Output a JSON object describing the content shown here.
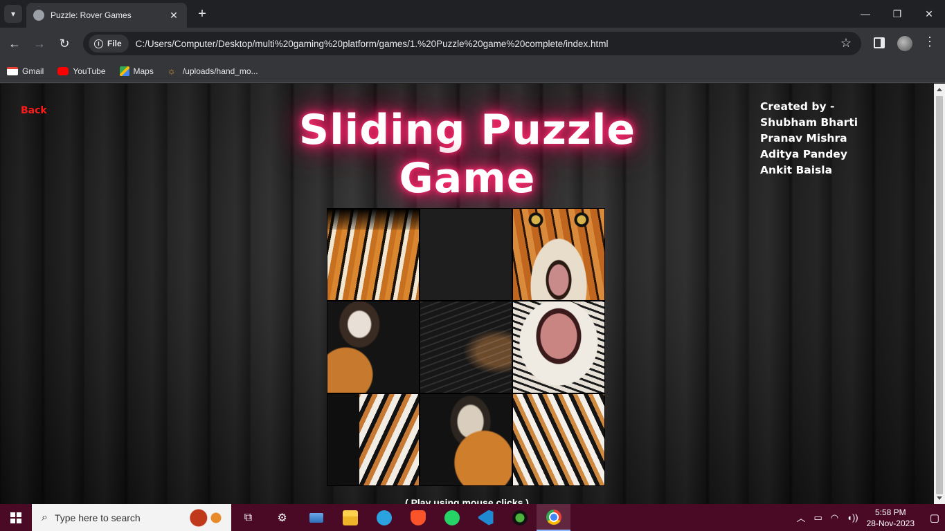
{
  "browser": {
    "tab_title": "Puzzle: Rover Games",
    "new_tab": "+",
    "close_tab": "✕",
    "file_chip": "File",
    "url": "C:/Users/Computer/Desktop/multi%20gaming%20platform/games/1.%20Puzzle%20game%20complete/index.html",
    "bookmarks": [
      "Gmail",
      "YouTube",
      "Maps",
      "/uploads/hand_mo..."
    ]
  },
  "page": {
    "back_label": "Back",
    "title": "Sliding Puzzle Game",
    "credits_heading": "Created by -",
    "authors": [
      "Shubham Bharti",
      "Pranav Mishra",
      "Aditya Pandey",
      "Ankit Baisla"
    ],
    "hint": "( Play using mouse clicks )"
  },
  "puzzle": {
    "grid": [
      [
        "tiger-back-fur",
        "empty",
        "tiger-eyes-nose"
      ],
      [
        "tiger-ear-left",
        "tiger-whisker-dark",
        "tiger-mouth-open"
      ],
      [
        "tiger-cheek-left",
        "tiger-ear-right",
        "tiger-cheek-right"
      ]
    ],
    "empty_position": "row 1, column 2"
  },
  "taskbar": {
    "search_placeholder": "Type here to search",
    "time": "5:58 PM",
    "date": "28-Nov-2023"
  },
  "colors": {
    "title_glow": "#ff2a6d",
    "back_link": "#ff1a1a",
    "taskbar": "#4a0a25"
  }
}
